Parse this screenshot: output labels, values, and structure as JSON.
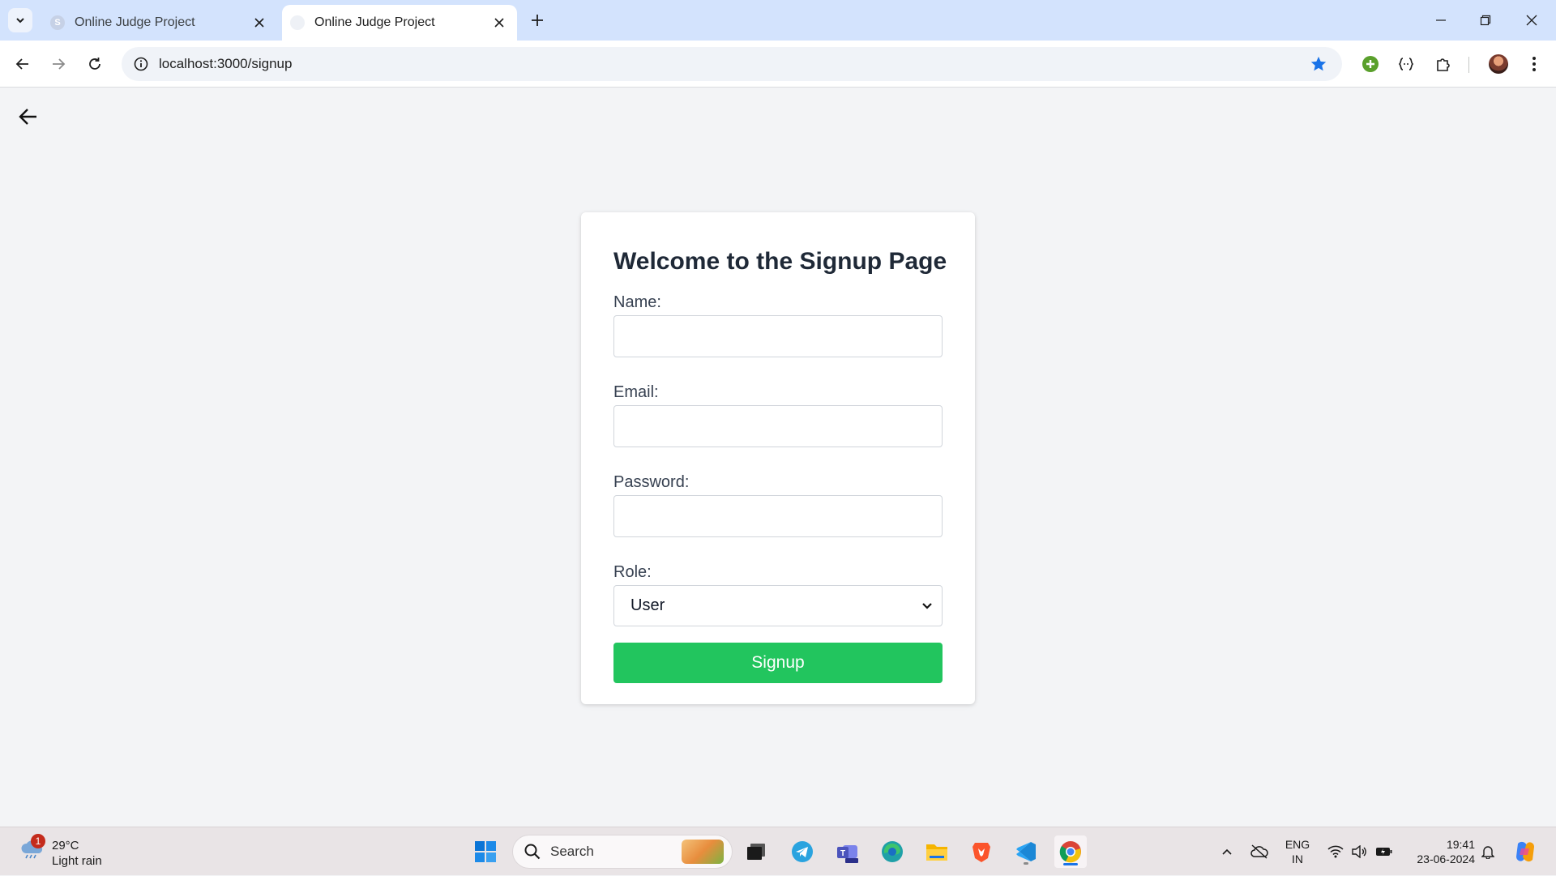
{
  "browser": {
    "tabs": [
      {
        "title": "Online Judge Project",
        "favicon": "S",
        "active": false
      },
      {
        "title": "Online Judge Project",
        "favicon": "",
        "active": true
      }
    ],
    "url": "localhost:3000/signup",
    "icons": {
      "tab_list": "chevron-down-icon",
      "new_tab": "plus-icon",
      "back": "arrow-left-icon",
      "forward": "arrow-right-icon",
      "reload": "reload-icon",
      "site_info": "info-icon",
      "bookmark": "star-icon",
      "extension_green": "plus-circle-icon",
      "extension_code": "braces-icon",
      "extensions": "puzzle-icon",
      "profile": "avatar",
      "menu": "kebab-menu-icon"
    },
    "bookmark_color": "#1a73e8"
  },
  "page": {
    "back_icon": "arrow-left-icon",
    "heading": "Welcome to the Signup Page",
    "fields": {
      "name_label": "Name:",
      "name_value": "",
      "email_label": "Email:",
      "email_value": "",
      "password_label": "Password:",
      "password_value": "",
      "role_label": "Role:",
      "role_selected": "User"
    },
    "submit_label": "Signup",
    "submit_color": "#22c55e"
  },
  "taskbar": {
    "weather": {
      "badge": "1",
      "temp": "29°C",
      "condition": "Light rain"
    },
    "search_placeholder": "Search",
    "apps": [
      "windows-start-icon",
      "task-view-icon",
      "telegram-icon",
      "teams-icon",
      "edge-icon",
      "file-explorer-icon",
      "brave-icon",
      "vscode-icon",
      "chrome-icon"
    ],
    "tray": {
      "language_top": "ENG",
      "language_bottom": "IN",
      "time": "19:41",
      "date": "23-06-2024"
    }
  }
}
